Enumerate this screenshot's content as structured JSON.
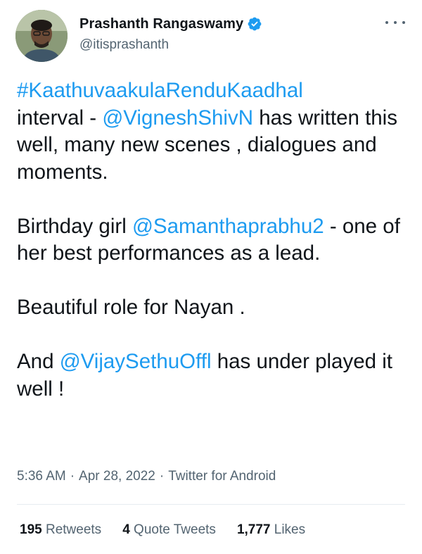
{
  "author": {
    "display_name": "Prashanth Rangaswamy",
    "handle": "@itisprashanth",
    "verified": true
  },
  "tweet": {
    "p1": {
      "hashtag": "#KaathuvaakulaRenduKaadhal",
      "t1": "interval - ",
      "mention": "@VigneshShivN",
      "t2": " has written this well, many new scenes , dialogues and moments."
    },
    "p2": {
      "t1": "Birthday girl ",
      "mention": "@Samanthaprabhu2",
      "t2": " - one of her best performances as a lead."
    },
    "p3": {
      "t1": "Beautiful role for Nayan ."
    },
    "p4": {
      "t1": "And ",
      "mention": "@VijaySethuOffl",
      "t2": " has under played it well !"
    }
  },
  "meta": {
    "time": "5:36 AM",
    "date": "Apr 28, 2022",
    "source": "Twitter for Android",
    "separator": "·"
  },
  "stats": {
    "retweets_count": "195",
    "retweets_label": "Retweets",
    "quotes_count": "4",
    "quotes_label": "Quote Tweets",
    "likes_count": "1,777",
    "likes_label": "Likes"
  },
  "colors": {
    "link": "#1d9bf0",
    "secondary_text": "#536471",
    "primary_text": "#0f1419",
    "verified_badge": "#1d9bf0"
  },
  "icons": {
    "verified": "verified-badge-icon",
    "more": "more-options-icon"
  }
}
